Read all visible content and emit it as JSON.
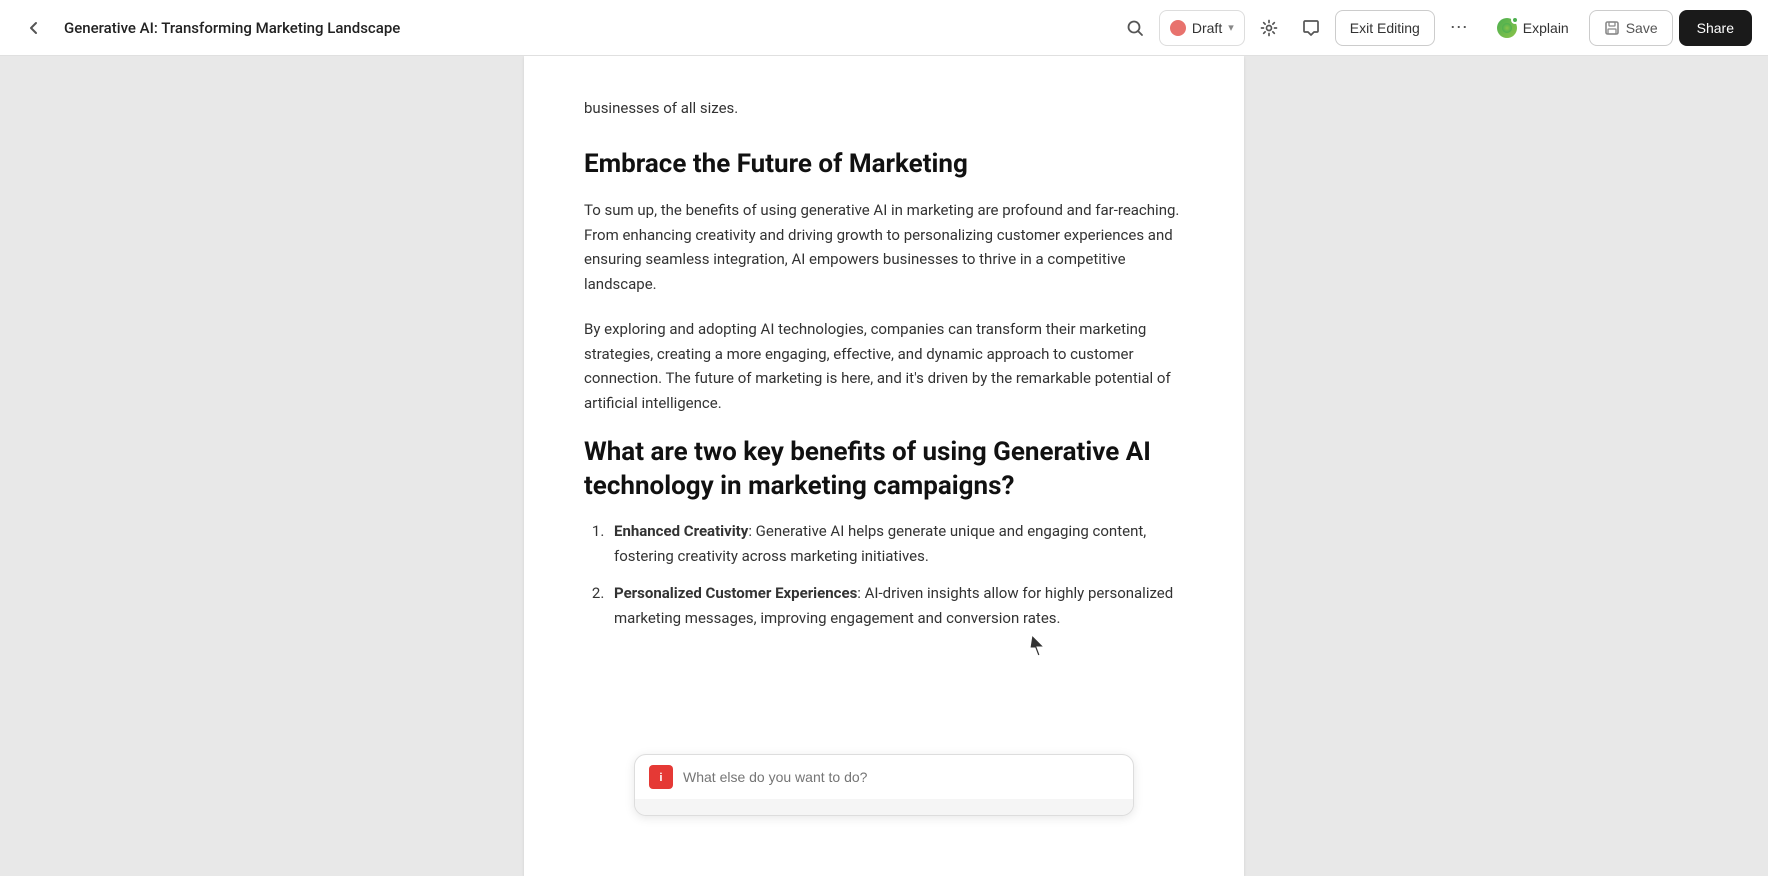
{
  "topbar": {
    "back_icon": "‹",
    "doc_title": "Generative AI: Transforming Marketing Landscape",
    "search_icon": "⌕",
    "draft_label": "Draft",
    "draft_color": "#e8726d",
    "settings_icon": "⚙",
    "comment_icon": "💬",
    "exit_editing_label": "Exit Editing",
    "more_icon": "⋯",
    "explain_label": "Explain",
    "save_icon": "💾",
    "save_label": "Save",
    "share_label": "Share"
  },
  "document": {
    "intro_text": "businesses of all sizes.",
    "section1": {
      "heading": "Embrace the Future of Marketing",
      "paragraph1": "To sum up, the benefits of using generative AI in marketing are profound and far-reaching. From enhancing creativity and driving growth to personalizing customer experiences and ensuring seamless integration, AI empowers businesses to thrive in a competitive landscape.",
      "paragraph2": "By exploring and adopting AI technologies, companies can transform their marketing strategies, creating a more engaging, effective, and dynamic approach to customer connection. The future of marketing is here, and it's driven by the remarkable potential of artificial intelligence."
    },
    "section2": {
      "heading": "What are two key benefits of using Generative AI technology in marketing campaigns?",
      "list_items": [
        {
          "bold": "Enhanced Creativity",
          "text": ": Generative AI helps generate unique and engaging content, fostering creativity across marketing initiatives."
        },
        {
          "bold": "Personalized Customer Experiences",
          "text": ": AI-driven insights allow for highly personalized marketing messages, improving engagement and conversion rates."
        }
      ]
    }
  },
  "chat_input": {
    "placeholder": "What else do you want to do?",
    "icon_label": "i"
  }
}
